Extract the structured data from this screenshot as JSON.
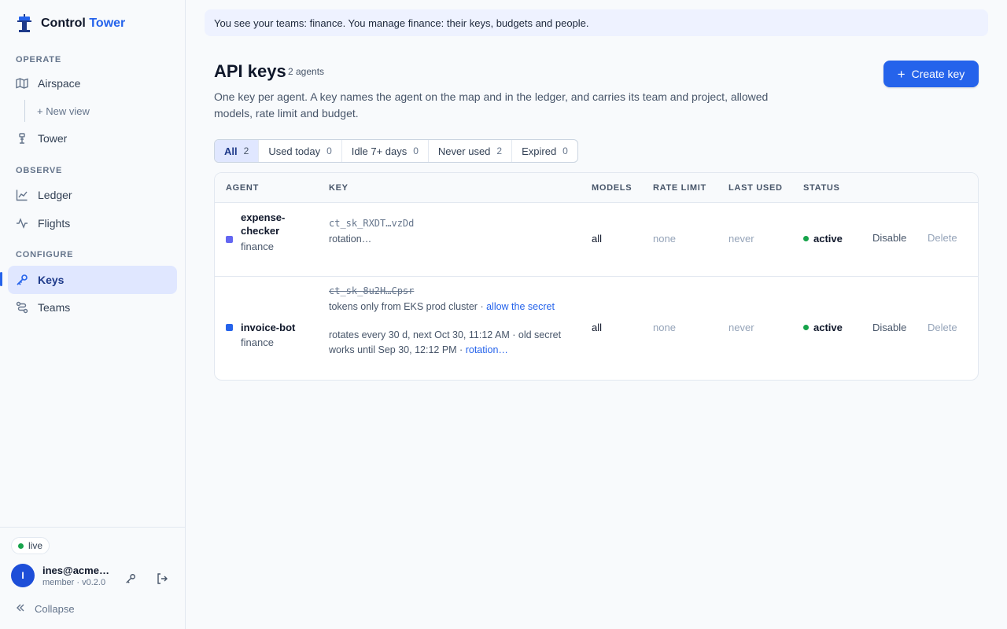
{
  "app": {
    "brand_primary": "Control",
    "brand_accent": "Tower",
    "accent_color": "#2563eb"
  },
  "sidebar": {
    "sections": {
      "operate": "OPERATE",
      "observe": "OBSERVE",
      "configure": "CONFIGURE"
    },
    "items": [
      {
        "label": "Airspace",
        "icon": "map-icon"
      },
      {
        "label": "Tower",
        "icon": "tower-icon"
      },
      {
        "label": "Ledger",
        "icon": "chart-line-icon"
      },
      {
        "label": "Flights",
        "icon": "activity-icon"
      },
      {
        "label": "Keys",
        "icon": "key-icon",
        "active": true
      },
      {
        "label": "Teams",
        "icon": "teams-icon"
      }
    ],
    "new_view_label": "+ New view",
    "status_label": "live",
    "user": {
      "initial": "I",
      "email": "ines@acme.com",
      "meta": "member · v0.2.0"
    },
    "collapse_label": "Collapse"
  },
  "banner": {
    "text": "You see your teams: finance. You manage finance: their keys, budgets and people."
  },
  "page": {
    "title": "API keys",
    "count": "2 agents",
    "create_label": "Create key",
    "description": "One key per agent. A key names the agent on the map and in the ledger, and carries its team and project, allowed models, rate limit and budget."
  },
  "filters": [
    {
      "label": "All",
      "count": "2",
      "active": true
    },
    {
      "label": "Used today",
      "count": "0"
    },
    {
      "label": "Idle 7+ days",
      "count": "0"
    },
    {
      "label": "Never used",
      "count": "2"
    },
    {
      "label": "Expired",
      "count": "0"
    }
  ],
  "table": {
    "headers": [
      "AGENT",
      "KEY",
      "MODELS",
      "RATE LIMIT",
      "LAST USED",
      "STATUS"
    ],
    "rows": [
      {
        "agent_line1": "expense-",
        "agent_line2": "checker",
        "team": "finance",
        "dot_color": "#6366f1",
        "key": "ct_sk_RXDT…vzDd",
        "key_link": "rotation…",
        "models": "all",
        "rate_limit": "none",
        "last_used": "never",
        "status": "active",
        "disable": "Disable",
        "delete": "Delete"
      },
      {
        "agent": "invoice-bot",
        "team": "finance",
        "dot_color": "#2563eb",
        "key": "ct_sk_8u2H…Cpsr",
        "token_note": "tokens only from EKS prod cluster · ",
        "token_link": "allow the secret",
        "rotate_line1": "rotates every 30 d, next Oct 30, 11:12 AM · old secret",
        "rotate_line2": "works until Sep 30, 12:12 PM · ",
        "rotate_link": "rotation…",
        "models": "all",
        "rate_limit": "none",
        "last_used": "never",
        "status": "active",
        "disable": "Disable",
        "delete": "Delete"
      }
    ]
  }
}
